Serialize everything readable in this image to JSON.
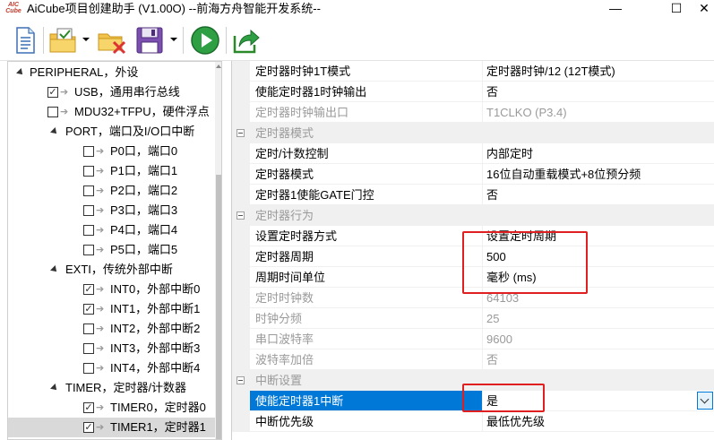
{
  "window": {
    "title": "AiCube项目创建助手 (V1.00O) --前海方舟智能开发系统--",
    "logo_text": "AIC Cube",
    "min_glyph": "—",
    "max_glyph": "☐",
    "close_glyph": "✕"
  },
  "toolbar": {
    "icons": [
      "new-file-icon",
      "open-folder-icon",
      "close-folder-icon",
      "save-icon",
      "run-icon",
      "export-icon"
    ]
  },
  "tree": {
    "items": [
      {
        "label": "PERIPHERAL，外设",
        "indent": 0,
        "expand": true,
        "check": null
      },
      {
        "label": "USB，通用串行总线",
        "indent": 2,
        "expand": false,
        "check": true
      },
      {
        "label": "MDU32+TFPU，硬件浮点",
        "indent": 2,
        "expand": false,
        "check": false
      },
      {
        "label": "PORT，端口及I/O口中断",
        "indent": 1,
        "expand": true,
        "check": null
      },
      {
        "label": "P0口，端口0",
        "indent": 3,
        "expand": false,
        "check": false
      },
      {
        "label": "P1口，端口1",
        "indent": 3,
        "expand": false,
        "check": false
      },
      {
        "label": "P2口，端口2",
        "indent": 3,
        "expand": false,
        "check": false
      },
      {
        "label": "P3口，端口3",
        "indent": 3,
        "expand": false,
        "check": false
      },
      {
        "label": "P4口，端口4",
        "indent": 3,
        "expand": false,
        "check": false
      },
      {
        "label": "P5口，端口5",
        "indent": 3,
        "expand": false,
        "check": false
      },
      {
        "label": "EXTI，传统外部中断",
        "indent": 1,
        "expand": true,
        "check": null
      },
      {
        "label": "INT0，外部中断0",
        "indent": 3,
        "expand": false,
        "check": true
      },
      {
        "label": "INT1，外部中断1",
        "indent": 3,
        "expand": false,
        "check": true
      },
      {
        "label": "INT2，外部中断2",
        "indent": 3,
        "expand": false,
        "check": false
      },
      {
        "label": "INT3，外部中断3",
        "indent": 3,
        "expand": false,
        "check": false
      },
      {
        "label": "INT4，外部中断4",
        "indent": 3,
        "expand": false,
        "check": false
      },
      {
        "label": "TIMER，定时器/计数器",
        "indent": 1,
        "expand": true,
        "check": null
      },
      {
        "label": "TIMER0，定时器0",
        "indent": 3,
        "expand": false,
        "check": true
      },
      {
        "label": "TIMER1，定时器1",
        "indent": 3,
        "expand": false,
        "check": true,
        "selected": true
      }
    ]
  },
  "props": {
    "rows": [
      {
        "type": "prop",
        "name": "定时器时钟1T模式",
        "value": "定时器时钟/12 (12T模式)"
      },
      {
        "type": "prop",
        "name": "使能定时器1时钟输出",
        "value": "否"
      },
      {
        "type": "prop",
        "name": "定时器时钟输出口",
        "value": "T1CLKO (P3.4)",
        "disabled": true
      },
      {
        "type": "cat",
        "name": "定时器模式"
      },
      {
        "type": "prop",
        "name": "定时/计数控制",
        "value": "内部定时"
      },
      {
        "type": "prop",
        "name": "定时器模式",
        "value": "16位自动重载模式+8位预分频"
      },
      {
        "type": "prop",
        "name": "定时器1使能GATE门控",
        "value": "否"
      },
      {
        "type": "cat",
        "name": "定时器行为"
      },
      {
        "type": "prop",
        "name": "设置定时器方式",
        "value": "设置定时周期"
      },
      {
        "type": "prop",
        "name": "定时器周期",
        "value": "500"
      },
      {
        "type": "prop",
        "name": "周期时间单位",
        "value": "毫秒 (ms)"
      },
      {
        "type": "prop",
        "name": "定时时钟数",
        "value": "64103",
        "disabled": true
      },
      {
        "type": "prop",
        "name": "时钟分频",
        "value": "25",
        "disabled": true
      },
      {
        "type": "prop",
        "name": "串口波特率",
        "value": "9600",
        "disabled": true
      },
      {
        "type": "prop",
        "name": "波特率加倍",
        "value": "否",
        "disabled": true
      },
      {
        "type": "cat",
        "name": "中断设置"
      },
      {
        "type": "prop",
        "name": "使能定时器1中断",
        "value": "是",
        "selected": true
      },
      {
        "type": "prop",
        "name": "中断优先级",
        "value": "最低优先级"
      }
    ]
  },
  "colors": {
    "selection": "#0078d7",
    "highlight_box": "#e02020"
  }
}
